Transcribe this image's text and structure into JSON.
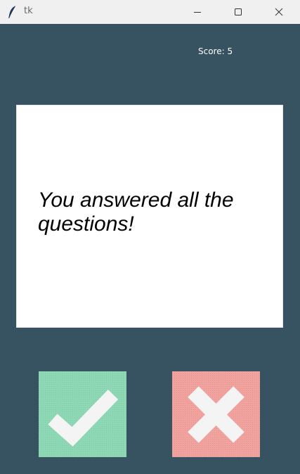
{
  "window": {
    "title": "tk"
  },
  "score": {
    "label": "Score: 5"
  },
  "card": {
    "text": "You answered all the questions!"
  },
  "buttons": {
    "true_icon": "check-icon",
    "false_icon": "cross-icon"
  },
  "colors": {
    "background": "#375362",
    "card": "#ffffff",
    "true_button": "#8fd8b6",
    "false_button": "#f1a3a0",
    "icon_fill": "#f4f4f4"
  }
}
